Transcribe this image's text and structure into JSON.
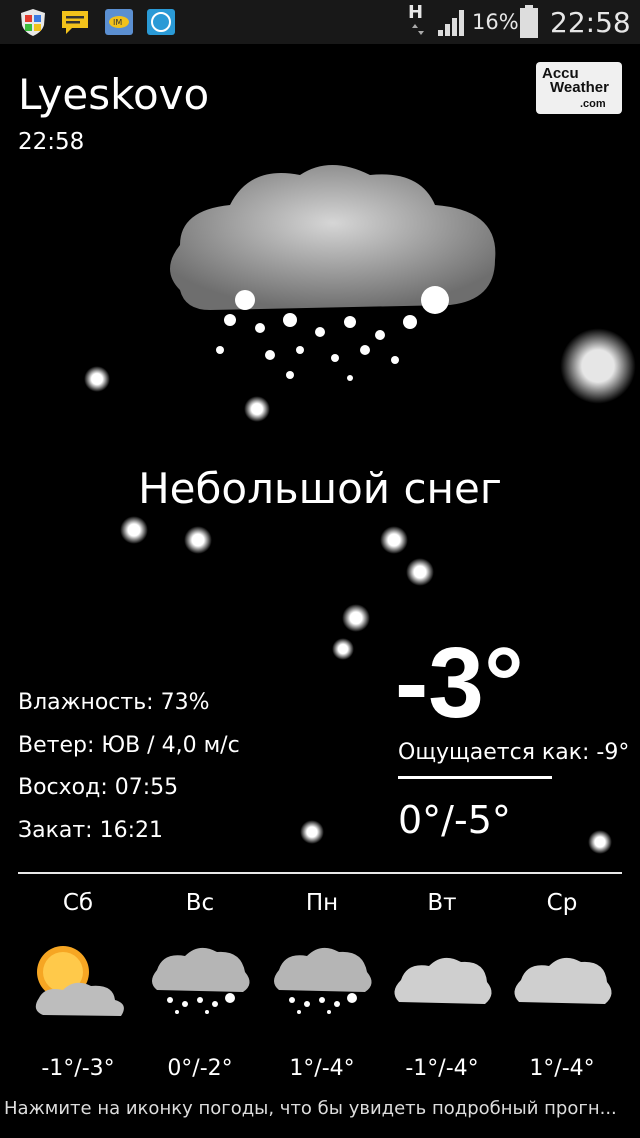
{
  "statusbar": {
    "network_type": "H",
    "battery": "16%",
    "clock": "22:58",
    "icons": [
      "shield-icon",
      "message-icon",
      "app-icon",
      "clock-app-icon",
      "signal-icon",
      "battery-icon"
    ]
  },
  "location": {
    "city": "Lyeskovo",
    "time": "22:58"
  },
  "logo": {
    "line1": "Accu",
    "line2": "Weather",
    "line3": ".com"
  },
  "current": {
    "condition": "Небольшой снег",
    "icon": "snow-cloud-icon",
    "temperature": "-3°",
    "feels_like": "Ощущается как: -9°",
    "hi_lo": "0°/-5°",
    "humidity": "Влажность: 73%",
    "wind": "Ветер: ЮВ / 4,0 м/с",
    "sunrise": "Восход: 07:55",
    "sunset": "Закат: 16:21"
  },
  "forecast": [
    {
      "day": "Сб",
      "range": "-1°/-3°",
      "icon": "sun-cloud-icon"
    },
    {
      "day": "Вс",
      "range": "0°/-2°",
      "icon": "snow-cloud-icon"
    },
    {
      "day": "Пн",
      "range": "1°/-4°",
      "icon": "snow-cloud-icon"
    },
    {
      "day": "Вт",
      "range": "-1°/-4°",
      "icon": "cloud-icon"
    },
    {
      "day": "Ср",
      "range": "1°/-4°",
      "icon": "cloud-icon"
    }
  ],
  "hint": "Нажмите на иконку погоды, что бы увидеть подробный прогн...",
  "colors": {
    "background": "#000000",
    "statusbar": "#181818",
    "text": "#ffffff"
  }
}
